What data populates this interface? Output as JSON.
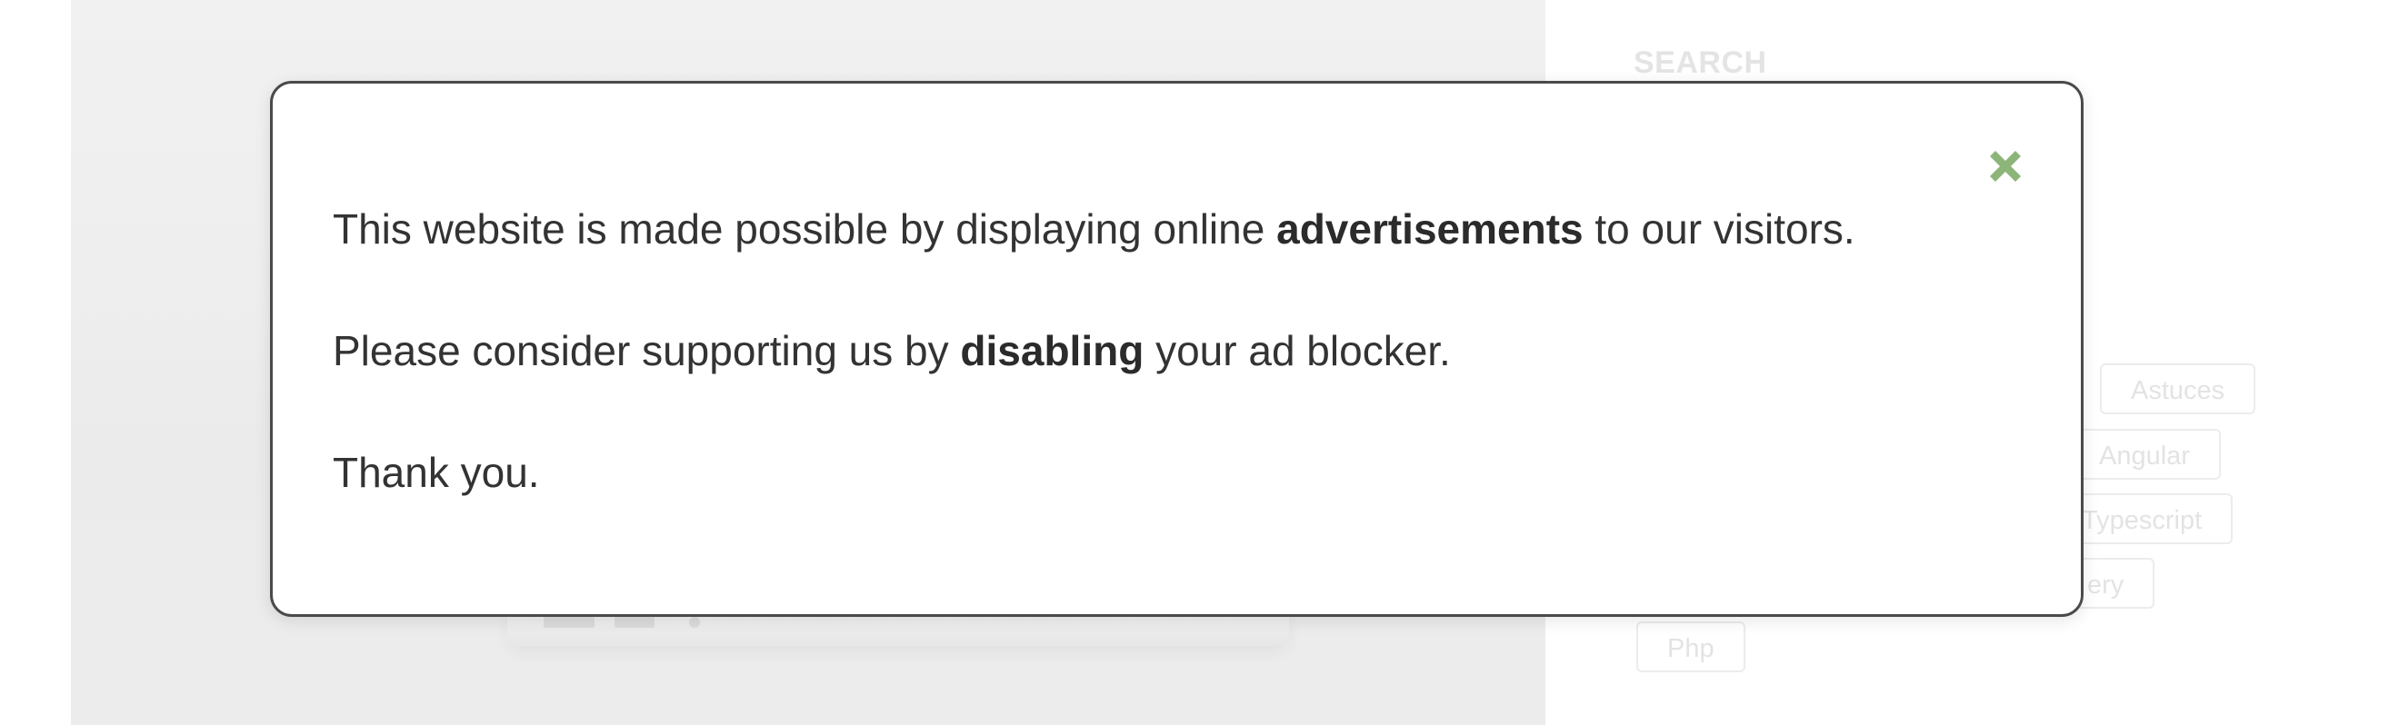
{
  "sidebar": {
    "title": "SEARCH",
    "tags": [
      "Astuces",
      "Angular",
      "Typescript",
      "ery",
      "Php"
    ]
  },
  "modal": {
    "line1": {
      "before": "This website is made possible by displaying online ",
      "bold": "advertisements",
      "after": " to our visitors."
    },
    "line2": {
      "before": "Please consider supporting us by ",
      "bold": "disabling",
      "after": " your ad blocker."
    },
    "line3": "Thank you.",
    "close_icon": "close-icon",
    "close_color": "#8db57a"
  },
  "colors": {
    "modal_border": "#4a4a4a",
    "text": "#333333",
    "accent_green": "#8db57a"
  }
}
